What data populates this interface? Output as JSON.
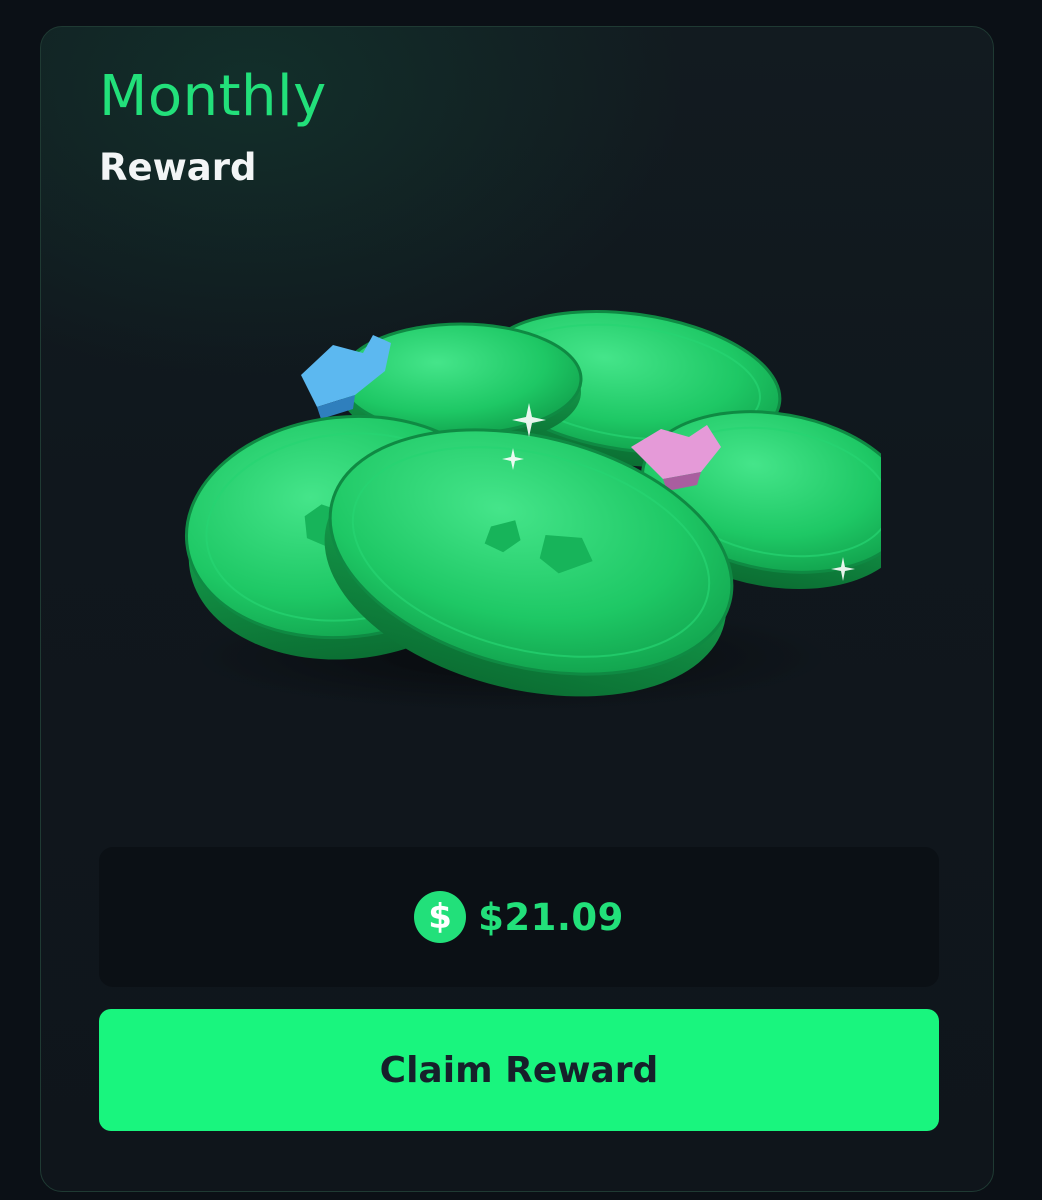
{
  "card": {
    "title": "Monthly",
    "subtitle": "Reward",
    "image": "green-coins-icon"
  },
  "reward": {
    "currency_icon": "dollar-icon",
    "currency_symbol": "$",
    "amount": "$21.09"
  },
  "actions": {
    "claim_label": "Claim Reward"
  },
  "colors": {
    "accent": "#22e07a",
    "button": "#19f57e",
    "card_bg": "#10171d",
    "page_bg": "#0b1016"
  }
}
